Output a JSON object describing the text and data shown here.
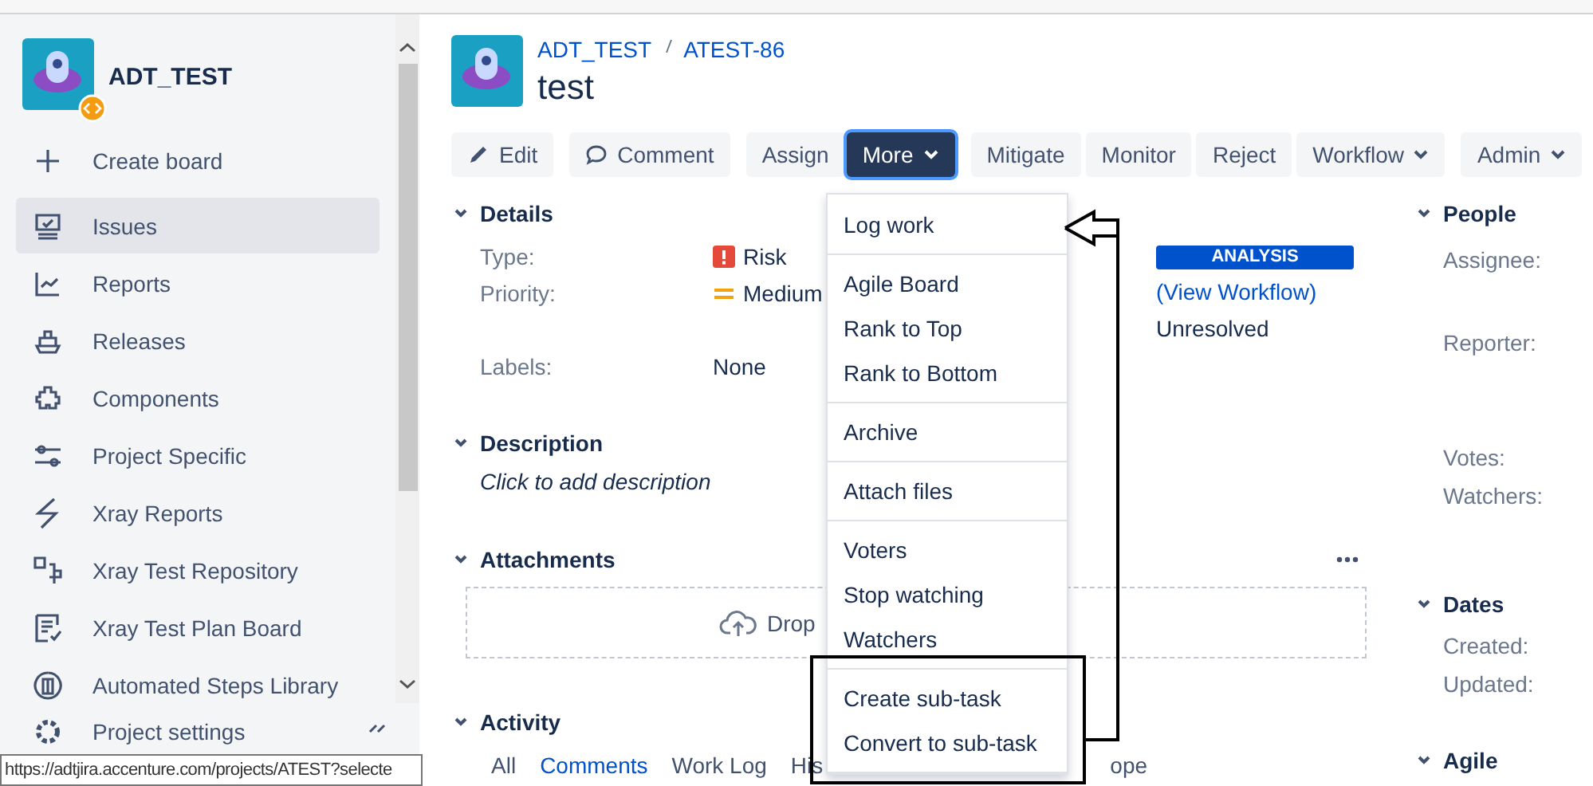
{
  "sidebar": {
    "project": "ADT_TEST",
    "items": [
      {
        "label": "Create board",
        "selected": false
      },
      {
        "label": "Issues",
        "selected": true
      },
      {
        "label": "Reports",
        "selected": false
      },
      {
        "label": "Releases",
        "selected": false
      },
      {
        "label": "Components",
        "selected": false
      },
      {
        "label": "Project Specific",
        "selected": false
      },
      {
        "label": "Xray Reports",
        "selected": false
      },
      {
        "label": "Xray Test Repository",
        "selected": false
      },
      {
        "label": "Xray Test Plan Board",
        "selected": false
      },
      {
        "label": "Automated Steps Library",
        "selected": false
      }
    ],
    "footer_item": "Project settings"
  },
  "issue": {
    "breadcrumb": [
      "ADT_TEST",
      "ATEST-86"
    ],
    "title": "test"
  },
  "toolbar": [
    [
      {
        "label": "Edit",
        "kind": "edit",
        "selected": false
      }
    ],
    [
      {
        "label": "Comment",
        "kind": "comment",
        "selected": false
      }
    ],
    [
      {
        "label": "Assign",
        "kind": "plain",
        "selected": false
      },
      {
        "label": "More",
        "kind": "menu",
        "selected": true
      }
    ],
    [
      {
        "label": "Mitigate",
        "kind": "plain",
        "selected": false
      },
      {
        "label": "Monitor",
        "kind": "plain",
        "selected": false
      },
      {
        "label": "Reject",
        "kind": "plain",
        "selected": false
      },
      {
        "label": "Workflow",
        "kind": "menu",
        "selected": false
      }
    ],
    [
      {
        "label": "Admin",
        "kind": "menu",
        "selected": false
      }
    ]
  ],
  "details": {
    "heading": "Details",
    "fields": [
      {
        "label": "Type:",
        "value": "Risk",
        "kind": "type"
      },
      {
        "label": "Priority:",
        "value": "Medium",
        "kind": "priority"
      },
      {
        "label": "Labels:",
        "value": "None",
        "kind": "plain"
      }
    ],
    "status": "ANALYSIS",
    "workflow_link": "(View Workflow)",
    "resolution": "Unresolved"
  },
  "description": {
    "heading": "Description",
    "prompt": "Click to add description"
  },
  "attachments": {
    "heading": "Attachments",
    "drop_text": "Drop"
  },
  "activity": {
    "heading": "Activity",
    "tabs": [
      {
        "label": "All",
        "selected": false
      },
      {
        "label": "Comments",
        "selected": true
      },
      {
        "label": "Work Log",
        "selected": false
      },
      {
        "label": "His",
        "selected": false
      }
    ],
    "cut_text": "ope"
  },
  "side_panels": [
    {
      "heading": "People",
      "labels": [
        "Assignee:",
        "Reporter:",
        "Votes:",
        "Watchers:"
      ]
    },
    {
      "heading": "Dates",
      "labels": [
        "Created:",
        "Updated:"
      ]
    },
    {
      "heading": "Agile"
    }
  ],
  "more_menu": {
    "sections": [
      [
        "Log work"
      ],
      [
        "Agile Board",
        "Rank to Top",
        "Rank to Bottom"
      ],
      [
        "Archive"
      ],
      [
        "Attach files"
      ],
      [
        "Voters",
        "Stop watching",
        "Watchers"
      ],
      [
        "Create sub-task",
        "Convert to sub-task"
      ]
    ]
  },
  "status_tooltip": "https://adtjira.accenture.com/projects/ATEST?selecte"
}
